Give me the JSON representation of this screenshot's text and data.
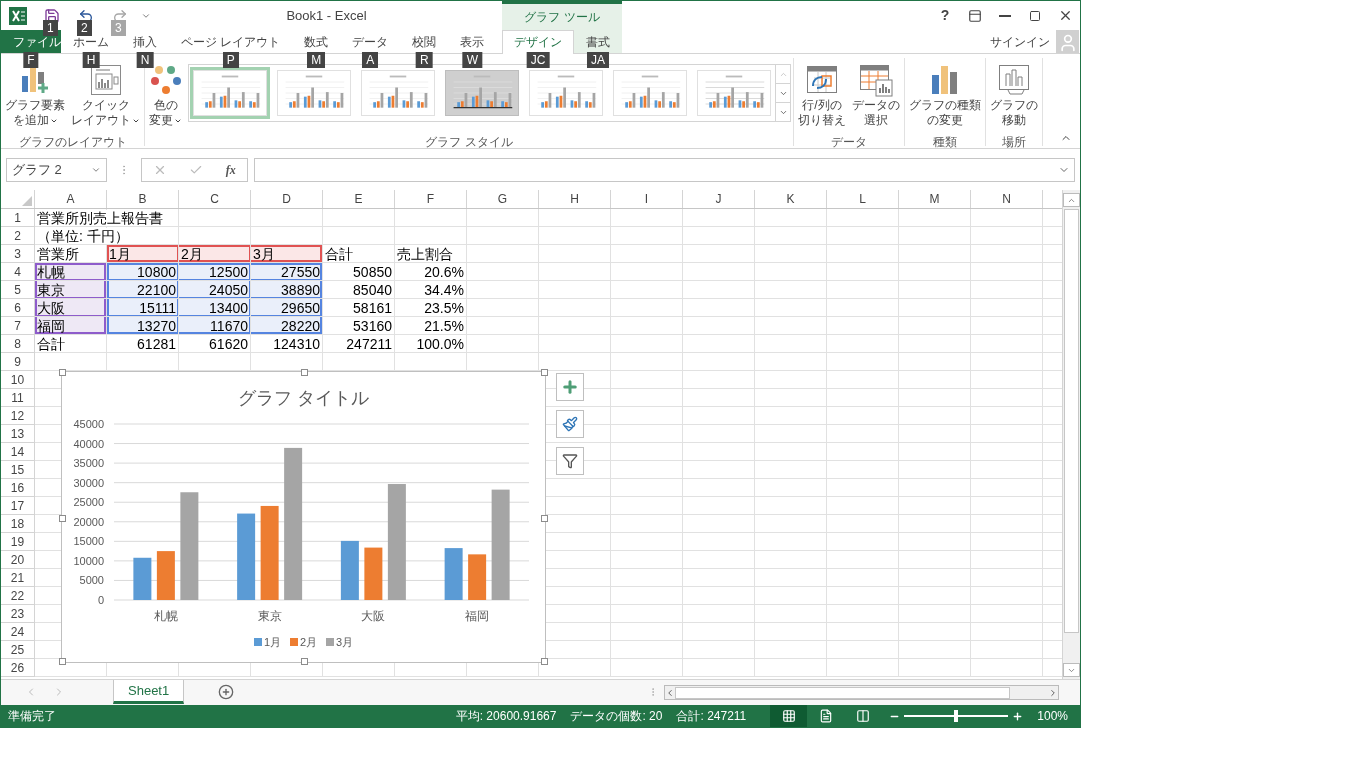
{
  "title_bar": {
    "title": "Book1 - Excel",
    "context_label": "グラフ ツール",
    "help": "?"
  },
  "quick_access": [
    {
      "kind": "save",
      "keytip": "1",
      "disabled": false
    },
    {
      "kind": "undo",
      "keytip": "2",
      "disabled": false
    },
    {
      "kind": "redo",
      "keytip": "3",
      "disabled": true
    }
  ],
  "tabs": [
    {
      "label": "ファイル",
      "keytip": "F",
      "kind": "file",
      "selected": false
    },
    {
      "label": "ホーム",
      "keytip": "H",
      "kind": "normal",
      "selected": false
    },
    {
      "label": "挿入",
      "keytip": "N",
      "kind": "normal",
      "selected": false
    },
    {
      "label": "ページ レイアウト",
      "keytip": "P",
      "kind": "normal",
      "selected": false
    },
    {
      "label": "数式",
      "keytip": "M",
      "kind": "normal",
      "selected": false
    },
    {
      "label": "データ",
      "keytip": "A",
      "kind": "normal",
      "selected": false
    },
    {
      "label": "校閲",
      "keytip": "R",
      "kind": "normal",
      "selected": false
    },
    {
      "label": "表示",
      "keytip": "W",
      "kind": "normal",
      "selected": false
    },
    {
      "label": "デザイン",
      "keytip": "JC",
      "kind": "context",
      "selected": true
    },
    {
      "label": "書式",
      "keytip": "JA",
      "kind": "context",
      "selected": false
    }
  ],
  "account": {
    "label": "サインイン"
  },
  "ribbon": {
    "groups": [
      {
        "label": "グラフのレイアウト",
        "buttons": [
          {
            "kind": "add-element",
            "lines": [
              "グラフ要素",
              "を追加"
            ],
            "dropdown": true
          },
          {
            "kind": "quick-layout",
            "lines": [
              "クイック",
              "レイアウト"
            ],
            "dropdown": true
          }
        ]
      },
      {
        "label": "グラフ スタイル",
        "buttons": [
          {
            "kind": "colors",
            "lines": [
              "色の",
              "変更"
            ],
            "dropdown": true
          }
        ],
        "gallery": [
          {
            "selected": true
          },
          {
            "selected": false
          },
          {
            "selected": false
          },
          {
            "selected": false
          },
          {
            "selected": false
          },
          {
            "selected": false
          },
          {
            "selected": false
          }
        ]
      },
      {
        "label": "データ",
        "buttons": [
          {
            "kind": "switch",
            "lines": [
              "行/列の",
              "切り替え"
            ],
            "dropdown": false
          },
          {
            "kind": "select-data",
            "lines": [
              "データの",
              "選択"
            ],
            "dropdown": false
          }
        ]
      },
      {
        "label": "種類",
        "buttons": [
          {
            "kind": "chart-type",
            "lines": [
              "グラフの種類",
              "の変更"
            ],
            "dropdown": false
          }
        ]
      },
      {
        "label": "場所",
        "buttons": [
          {
            "kind": "move",
            "lines": [
              "グラフの",
              "移動"
            ],
            "dropdown": false
          }
        ]
      }
    ]
  },
  "formula_bar": {
    "name_box": "グラフ 2",
    "insert_function": "fx"
  },
  "sheet": {
    "columns": [
      "A",
      "B",
      "C",
      "D",
      "E",
      "F",
      "G",
      "H",
      "I",
      "J",
      "K",
      "L",
      "M",
      "N"
    ],
    "rows": [
      {
        "number": "1",
        "cells": [
          {
            "text": "営業所別売上報告書",
            "kind": "text"
          }
        ]
      },
      {
        "number": "2",
        "cells": [
          {
            "text": "（単位: 千円）",
            "kind": "text"
          }
        ]
      },
      {
        "number": "3",
        "cells": [
          {
            "text": "営業所",
            "kind": "text"
          },
          {
            "text": "1月",
            "kind": "series"
          },
          {
            "text": "2月",
            "kind": "series"
          },
          {
            "text": "3月",
            "kind": "series"
          },
          {
            "text": "合計",
            "kind": "text"
          },
          {
            "text": "売上割合",
            "kind": "text"
          }
        ]
      },
      {
        "number": "4",
        "cells": [
          {
            "text": "札幌",
            "kind": "category"
          },
          {
            "text": "10800",
            "kind": "value"
          },
          {
            "text": "12500",
            "kind": "value"
          },
          {
            "text": "27550",
            "kind": "value"
          },
          {
            "text": "50850",
            "kind": "number"
          },
          {
            "text": "20.6%",
            "kind": "number"
          }
        ]
      },
      {
        "number": "5",
        "cells": [
          {
            "text": "東京",
            "kind": "category"
          },
          {
            "text": "22100",
            "kind": "value"
          },
          {
            "text": "24050",
            "kind": "value"
          },
          {
            "text": "38890",
            "kind": "value"
          },
          {
            "text": "85040",
            "kind": "number"
          },
          {
            "text": "34.4%",
            "kind": "number"
          }
        ]
      },
      {
        "number": "6",
        "cells": [
          {
            "text": "大阪",
            "kind": "category"
          },
          {
            "text": "15111",
            "kind": "value"
          },
          {
            "text": "13400",
            "kind": "value"
          },
          {
            "text": "29650",
            "kind": "value"
          },
          {
            "text": "58161",
            "kind": "number"
          },
          {
            "text": "23.5%",
            "kind": "number"
          }
        ]
      },
      {
        "number": "7",
        "cells": [
          {
            "text": "福岡",
            "kind": "category"
          },
          {
            "text": "13270",
            "kind": "value"
          },
          {
            "text": "11670",
            "kind": "value"
          },
          {
            "text": "28220",
            "kind": "value"
          },
          {
            "text": "53160",
            "kind": "number"
          },
          {
            "text": "21.5%",
            "kind": "number"
          }
        ]
      },
      {
        "number": "8",
        "cells": [
          {
            "text": "合計",
            "kind": "text"
          },
          {
            "text": "61281",
            "kind": "number"
          },
          {
            "text": "61620",
            "kind": "number"
          },
          {
            "text": "124310",
            "kind": "number"
          },
          {
            "text": "247211",
            "kind": "number"
          },
          {
            "text": "100.0%",
            "kind": "number"
          }
        ]
      },
      {
        "number": "9"
      },
      {
        "number": "10"
      },
      {
        "number": "11"
      },
      {
        "number": "12"
      },
      {
        "number": "13"
      },
      {
        "number": "14"
      },
      {
        "number": "15"
      },
      {
        "number": "16"
      },
      {
        "number": "17"
      },
      {
        "number": "18"
      },
      {
        "number": "19"
      },
      {
        "number": "20"
      },
      {
        "number": "21"
      },
      {
        "number": "22"
      },
      {
        "number": "23"
      },
      {
        "number": "24"
      },
      {
        "number": "25"
      },
      {
        "number": "26"
      }
    ]
  },
  "chart": {
    "chart_data": {
      "type": "bar",
      "title": "グラフ タイトル",
      "categories": [
        "札幌",
        "東京",
        "大阪",
        "福岡"
      ],
      "series": [
        {
          "name": "1月",
          "color": "#5b9bd5",
          "values": [
            10800,
            22100,
            15111,
            13270
          ]
        },
        {
          "name": "2月",
          "color": "#ed7d31",
          "values": [
            12500,
            24050,
            13400,
            11670
          ]
        },
        {
          "name": "3月",
          "color": "#a5a5a5",
          "values": [
            27550,
            38890,
            29650,
            28220
          ]
        }
      ],
      "grid": true,
      "legend": "bottom",
      "ylim": [
        0,
        45000
      ],
      "yticks": [
        0,
        5000,
        10000,
        15000,
        20000,
        25000,
        30000,
        35000,
        40000,
        45000
      ]
    }
  },
  "sheet_tabs": [
    {
      "label": "Sheet1",
      "selected": true
    }
  ],
  "status_bar": {
    "status": "準備完了",
    "stats": [
      "平均: 20600.91667",
      "データの個数: 20",
      "合計: 247211"
    ],
    "views": [
      {
        "kind": "normal",
        "selected": true
      },
      {
        "kind": "page-layout",
        "selected": false
      },
      {
        "kind": "page-break",
        "selected": false
      }
    ],
    "zoom": {
      "level": 0.5,
      "label": "100%"
    }
  }
}
